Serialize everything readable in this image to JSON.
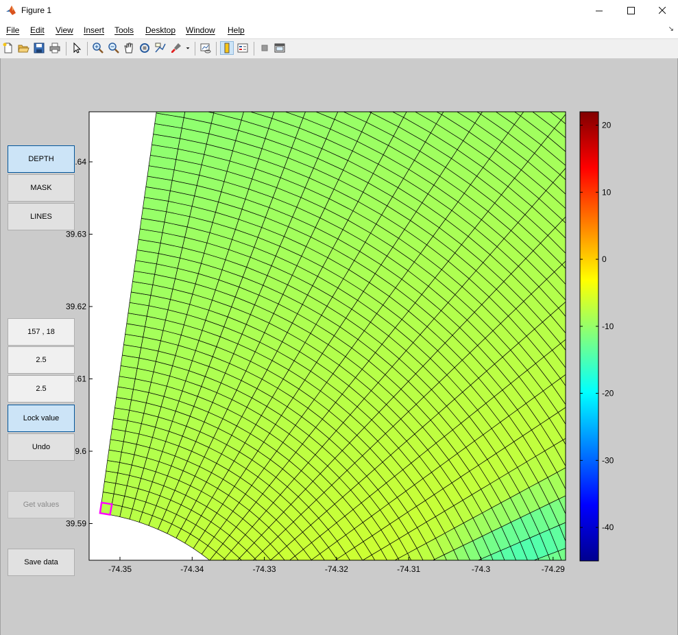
{
  "window": {
    "title": "Figure 1",
    "controls": {
      "minimize": "–",
      "maximize": "☐",
      "close": "✕"
    }
  },
  "menu": [
    "File",
    "Edit",
    "View",
    "Insert",
    "Tools",
    "Desktop",
    "Window",
    "Help"
  ],
  "toolbar": {
    "icons": [
      "new-file-icon",
      "open-folder-icon",
      "save-icon",
      "print-icon",
      "pointer-icon",
      "zoom-in-icon",
      "zoom-out-icon",
      "pan-hand-icon",
      "rotate-3d-icon",
      "data-cursor-icon",
      "brush-icon",
      "link-plot-icon",
      "colorbar-toggle-icon",
      "legend-toggle-icon",
      "hide-plot-tools-icon",
      "show-plot-tools-icon"
    ]
  },
  "buttons": {
    "depth": "DEPTH",
    "mask": "MASK",
    "lines": "LINES",
    "index": "157 , 18",
    "value1": "2.5",
    "value2": "2.5",
    "lock": "Lock value",
    "undo": "Undo",
    "get_values": "Get values",
    "save": "Save data"
  },
  "axes": {
    "x_ticks": [
      "-74.35",
      "-74.34",
      "-74.33",
      "-74.32",
      "-74.31",
      "-74.3",
      "-74.29"
    ],
    "y_ticks": [
      ".64",
      "39.63",
      "39.62",
      ".61",
      "9.6",
      "39.59"
    ]
  },
  "colorbar": {
    "ticks": [
      "20",
      "10",
      "0",
      "-10",
      "-20",
      "-30",
      "-40"
    ],
    "range": [
      -45,
      22
    ],
    "colormap": "jet"
  },
  "colors": {
    "grid_line": "#000000",
    "selection": "#ff00ff",
    "figure_bg": "#cbcbcb"
  }
}
